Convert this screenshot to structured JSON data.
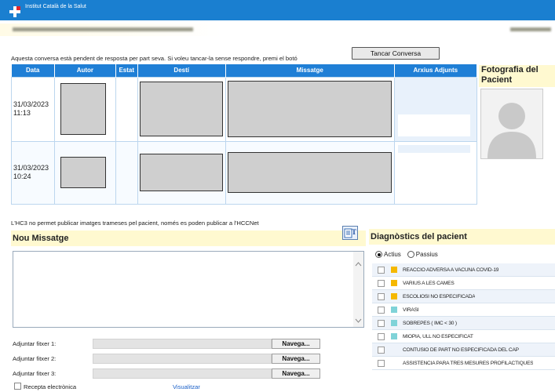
{
  "header": {
    "org_name": "Institut Català de la Salut"
  },
  "conversation": {
    "pending_text": "Aquesta conversa està pendent de resposta per part seva. Si voleu tancar-la sense respondre, premi el botó",
    "close_button": "Tancar Conversa",
    "columns": [
      "Data",
      "Autor",
      "Estat",
      "Destí",
      "Missatge",
      "Arxius Adjunts"
    ],
    "rows": [
      {
        "date": "31/03/2023 11:13"
      },
      {
        "date": "31/03/2023 10:24"
      }
    ]
  },
  "patient_photo": {
    "title": "Fotografia del Pacient"
  },
  "hc3_note": "L'HC3 no permet publicar imatges trameses pel pacient, només es poden publicar a l'HCCNet",
  "new_message": {
    "title": "Nou Missatge",
    "attachments": [
      {
        "label": "Adjuntar fitxer 1:",
        "button": "Navega..."
      },
      {
        "label": "Adjuntar fitxer 2:",
        "button": "Navega..."
      },
      {
        "label": "Adjuntar fitxer 3:",
        "button": "Navega..."
      }
    ],
    "e_prescription_label": "Recepta electrònica",
    "view_link": "Visualitzar"
  },
  "diagnostics": {
    "title": "Diagnòstics del pacient",
    "filter_active": "Actius",
    "filter_passive": "Passius",
    "selected_filter": "Actius",
    "items": [
      {
        "text": "REACCIÓ ADVERSA A VACUNA COVID-19",
        "color": "#f5b800"
      },
      {
        "text": "VARIUS A LES CAMES",
        "color": "#f5b800"
      },
      {
        "text": "ESCOLIOSI NO ESPECIFICADA",
        "color": "#f5b800"
      },
      {
        "text": "VIRASI",
        "color": "#7fd3d8"
      },
      {
        "text": "SOBREPÈS ( IMC < 30 )",
        "color": "#7fd3d8"
      },
      {
        "text": "MIOPIA, ULL NO ESPECIFICAT",
        "color": "#7fd3d8"
      },
      {
        "text": "CONTUSIÓ DE PART NO ESPECIFICADA DEL CAP",
        "color": ""
      },
      {
        "text": "ASSISTÈNCIA PARA TRES MESURES PROFILÀCTIQUES",
        "color": ""
      }
    ]
  },
  "colors": {
    "brand_blue": "#1f7fd6",
    "section_yellow": "#fff9d0"
  }
}
